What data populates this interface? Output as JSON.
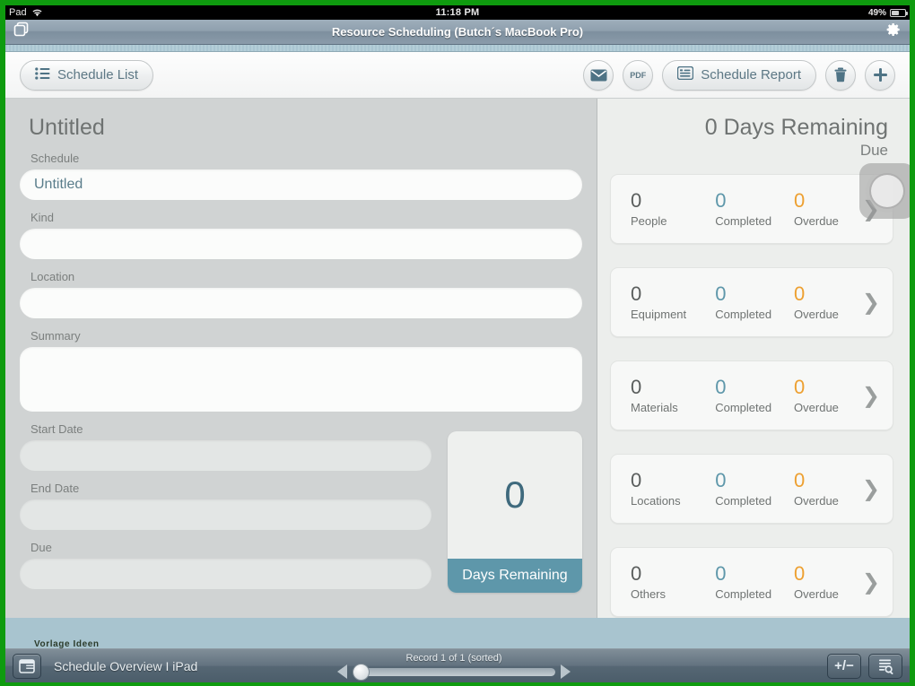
{
  "status_bar": {
    "carrier": "Pad",
    "wifi_icon": "wifi-icon",
    "time": "11:18 PM",
    "battery_percent": "49%",
    "battery_icon": "battery-icon"
  },
  "title_bar": {
    "left_icon": "windows-stack-icon",
    "title": "Resource Scheduling (Butch´s MacBook Pro)",
    "right_icon": "gear-icon"
  },
  "toolbar": {
    "schedule_list_label": "Schedule List",
    "schedule_list_icon": "list-icon",
    "email_icon": "envelope-icon",
    "pdf_label": "PDF",
    "schedule_report_label": "Schedule Report",
    "schedule_report_icon": "report-list-icon",
    "delete_icon": "trash-icon",
    "add_icon": "plus-icon"
  },
  "form": {
    "title": "Untitled",
    "fields": [
      {
        "label": "Schedule",
        "value": "Untitled",
        "placeholder": "",
        "style": "white"
      },
      {
        "label": "Kind",
        "value": "",
        "placeholder": "",
        "style": "white"
      },
      {
        "label": "Location",
        "value": "",
        "placeholder": "",
        "style": "white"
      },
      {
        "label": "Summary",
        "value": "",
        "placeholder": "",
        "style": "tall"
      }
    ],
    "date_fields": [
      {
        "label": "Start Date",
        "value": "",
        "placeholder": ""
      },
      {
        "label": "End Date",
        "value": "",
        "placeholder": ""
      },
      {
        "label": "Due",
        "value": "",
        "placeholder": ""
      }
    ],
    "days_card": {
      "value": "0",
      "caption": "Days Remaining"
    }
  },
  "summary": {
    "header_value": "0 Days Remaining",
    "header_sub": "Due",
    "column_labels": {
      "completed": "Completed",
      "overdue": "Overdue"
    },
    "cards": [
      {
        "count": "0",
        "label": "People",
        "completed": "0",
        "overdue": "0",
        "chevron": "chevron-right-icon"
      },
      {
        "count": "0",
        "label": "Equipment",
        "completed": "0",
        "overdue": "0",
        "chevron": "chevron-right-icon"
      },
      {
        "count": "0",
        "label": "Materials",
        "completed": "0",
        "overdue": "0",
        "chevron": "chevron-right-icon"
      },
      {
        "count": "0",
        "label": "Locations",
        "completed": "0",
        "overdue": "0",
        "chevron": "chevron-right-icon"
      },
      {
        "count": "0",
        "label": "Others",
        "completed": "0",
        "overdue": "0",
        "chevron": "chevron-right-icon"
      }
    ]
  },
  "background_text": "Vorlage Ideen",
  "bottom_bar": {
    "layout_icon": "layout-view-icon",
    "layout_name": "Schedule Overview I iPad",
    "record_text": "Record 1 of 1 (sorted)",
    "prev_icon": "triangle-left-icon",
    "next_icon": "triangle-right-icon",
    "edit_mode_label": "+/−",
    "find_icon": "document-search-icon"
  },
  "colors": {
    "accent_teal": "#5e97aa",
    "overdue_orange": "#eda031",
    "frame_green": "#0f9b0f",
    "neutral_text": "#6f7372"
  }
}
